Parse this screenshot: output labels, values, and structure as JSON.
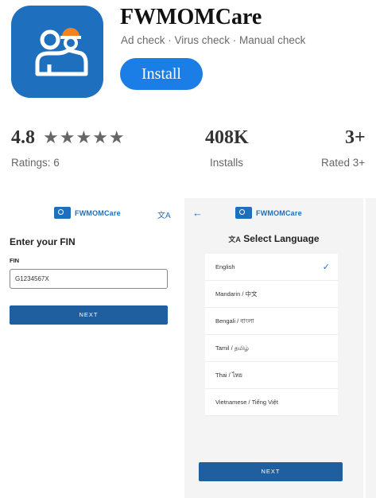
{
  "app": {
    "name": "FWMOMCare",
    "tags": "Ad check · Virus check · Manual check",
    "install_label": "Install"
  },
  "stats": {
    "rating": "4.8",
    "stars": "★★★★★",
    "ratings_label": "Ratings: 6",
    "installs": "408K",
    "installs_label": "Installs",
    "age": "3+",
    "age_label": "Rated 3+"
  },
  "screen_fin": {
    "brand": "FWMOMCare",
    "language_icon": "translate-icon",
    "title": "Enter your FIN",
    "field_label": "FIN",
    "field_value": "G1234567X",
    "next_label": "NEXT"
  },
  "screen_language": {
    "brand": "FWMOMCare",
    "back_icon": "back-arrow-icon",
    "title": "Select Language",
    "languages": [
      {
        "label": "English",
        "selected": true
      },
      {
        "label": "Mandarin / 中文",
        "selected": false
      },
      {
        "label": "Bengali / বাংলা",
        "selected": false
      },
      {
        "label": "Tamil / தமிழ்",
        "selected": false
      },
      {
        "label": "Thai / ไทย",
        "selected": false
      },
      {
        "label": "Vietnamese / Tiếng Việt",
        "selected": false
      }
    ],
    "next_label": "NEXT"
  },
  "colors": {
    "brand_blue": "#1e6fbd",
    "install_blue": "#1a7ee6",
    "button_blue": "#1f5fa0"
  }
}
